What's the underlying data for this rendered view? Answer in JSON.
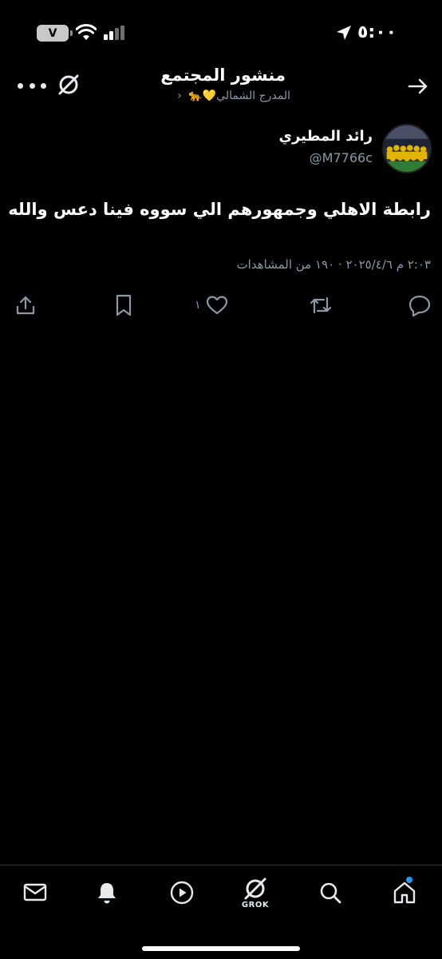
{
  "status_bar": {
    "time": "٥:٠٠",
    "battery": "V"
  },
  "header": {
    "title": "منشور المجتمع",
    "subtitle": "المدرج الشمالي💛🐆",
    "subtitle_chevron": "‹"
  },
  "post": {
    "author_name": "رائد المطيري",
    "author_handle": "@M7766c",
    "text": "رابطة الاهلي وجمهورهم الي سووه فينا دعس والله",
    "meta": "٢:٠٣ م ٢٠٢٥/٤/٦ · ١٩٠ من المشاهدات",
    "like_count": "١"
  },
  "bottom_nav": {
    "grok_label": "GROK"
  },
  "colors": {
    "background": "#000000",
    "text_primary": "#e7e9ea",
    "text_secondary": "#8b98a5",
    "accent": "#1d9bf0"
  }
}
